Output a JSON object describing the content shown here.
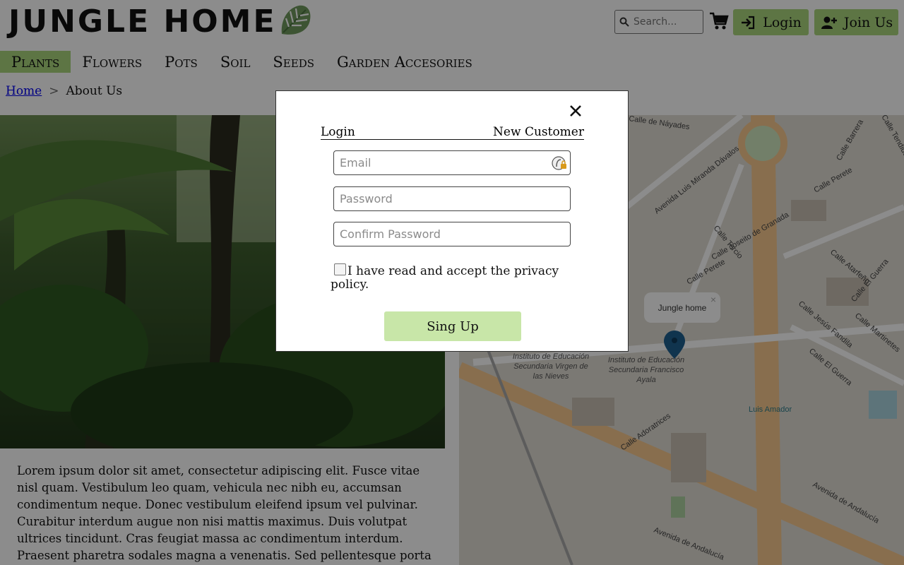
{
  "header": {
    "logo_text": "JUNGLE HOME",
    "search_placeholder": "Search...",
    "login_label": "Login",
    "join_label": "Join Us"
  },
  "nav": {
    "items": [
      "Plants",
      "Flowers",
      "Pots",
      "Soil",
      "Seeds",
      "Garden Accesories"
    ],
    "active": "Plants"
  },
  "breadcrumb": {
    "home": "Home",
    "separator": ">",
    "current": "About Us"
  },
  "content": {
    "paragraph": "Lorem ipsum dolor sit amet, consectetur adipiscing elit. Fusce vitae nisl quam. Vestibulum leo quam, vehicula nec nibh eu, accumsan condimentum neque. Donec vestibulum eleifend ipsum vel pulvinar. Curabitur interdum augue non nisi mattis maximus. Duis volutpat ultrices tincidunt. Cras feugiat massa ac condimentum interdum. Praesent pharetra sodales magna a venenatis. Sed pellentesque porta"
  },
  "map": {
    "popup_label": "Jungle home",
    "popup_close": "×",
    "labels": {
      "calle_tercio": "Calle Tercio",
      "calle_perete": "Calle Perete",
      "calle_atarfe": "Calle Atarfeño",
      "av_luis_miranda": "Avenida Luis Miranda Dávalos",
      "calle_joseito": "Calle Joseito de Granada",
      "instituto_virgen": "Instituto de Educación Secundaria Virgen de las Nieves",
      "instituto_ayala": "Instituto de Educación Secundaria Francisco Ayala",
      "calle_adoratrices": "Calle Adoratrices",
      "av_andalucia": "Avenida de Andalucía",
      "luis_amador": "Luis Amador",
      "calle_el_guerra": "Calle El Guerra",
      "calle_jesus_fandila": "Calle Jesús Fandila",
      "calle_martinetes": "Calle Martinetes",
      "calle_barrera": "Calle Barrera",
      "calle_tendido": "Calle Tendido",
      "calle_nayades": "Calle de Náyades"
    }
  },
  "modal": {
    "close": "×",
    "tab_login": "Login",
    "tab_new": "New Customer",
    "email_placeholder": "Email",
    "password_placeholder": "Password",
    "confirm_placeholder": "Confirm Password",
    "consent_text": "I have read and accept the privacy policy.",
    "signup_label": "Sing Up"
  },
  "colors": {
    "accent_green": "#a9d67d",
    "signup_green": "#c8e6a8",
    "overlay": "rgba(0,0,0,0.45)"
  }
}
